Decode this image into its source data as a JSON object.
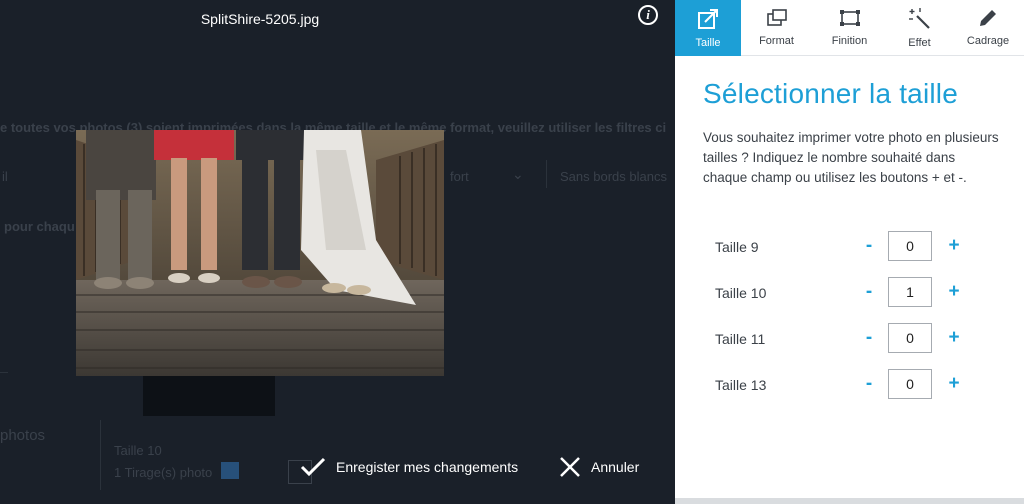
{
  "viewer": {
    "filename": "SplitShire-5205.jpg",
    "info_icon": "i",
    "save_label": "Enregister mes changements",
    "cancel_label": "Annuler"
  },
  "background_page": {
    "instruction": "e toutes vos photos (3) soient imprimées dans la même taille et le même format, veuillez utiliser les filtres ci",
    "field_left": "il",
    "field_mid": "fort",
    "field_right": "Sans bords blancs",
    "line_for": "pour chaqu",
    "photos_heading": "photos",
    "thumb_caption": "Taille 10",
    "thumb_count": "1 Tirage(s) photo"
  },
  "toolbar": {
    "items": [
      {
        "label": "Taille",
        "icon": "external-edit-icon",
        "active": true
      },
      {
        "label": "Format",
        "icon": "format-frames-icon",
        "active": false
      },
      {
        "label": "Finition",
        "icon": "crop-frame-icon",
        "active": false
      },
      {
        "label": "Effet",
        "icon": "magic-wand-icon",
        "active": false
      },
      {
        "label": "Cadrage",
        "icon": "pencil-icon",
        "active": false
      }
    ]
  },
  "panel": {
    "title": "Sélectionner la taille",
    "description": "Vous souhaitez imprimer votre photo en plusieurs tailles ? Indiquez le nombre souhaité dans chaque champ ou utilisez les boutons + et -.",
    "minus_symbol": "-",
    "plus_symbol": "+",
    "sizes": [
      {
        "label": "Taille 9",
        "qty": "0"
      },
      {
        "label": "Taille 10",
        "qty": "1"
      },
      {
        "label": "Taille 11",
        "qty": "0"
      },
      {
        "label": "Taille 13",
        "qty": "0"
      }
    ]
  },
  "colors": {
    "accent": "#1d9fd6",
    "viewer_bg": "#1a2029",
    "panel_bg": "#ffffff"
  }
}
